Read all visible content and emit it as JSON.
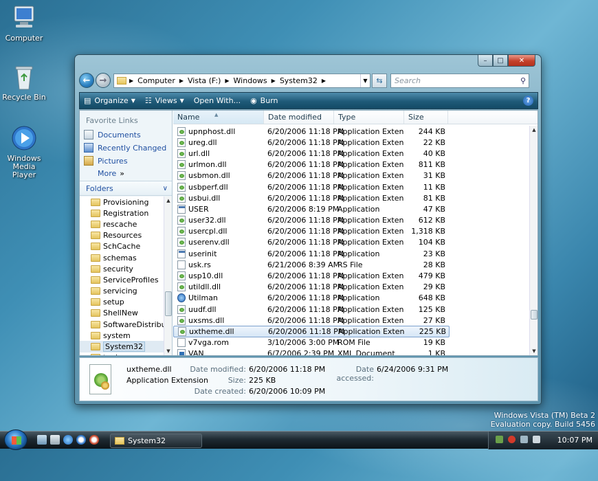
{
  "desktop": {
    "icons": [
      {
        "label": "Computer"
      },
      {
        "label": "Recycle Bin"
      },
      {
        "label": "Windows Media Player"
      }
    ],
    "watermark": {
      "line1": "Windows Vista (TM) Beta 2",
      "line2": "Evaluation copy. Build 5456"
    }
  },
  "window": {
    "caption_buttons": {
      "minimize": "–",
      "maximize": "□",
      "close": "✕"
    },
    "address": {
      "crumbs": [
        "Computer",
        "Vista (F:)",
        "Windows",
        "System32"
      ]
    },
    "search": {
      "placeholder": "Search"
    },
    "toolbar": {
      "organize": "Organize",
      "views": "Views",
      "open_with": "Open With...",
      "burn": "Burn",
      "help": "?"
    },
    "nav": {
      "favorite_links_title": "Favorite Links",
      "favorites": [
        "Documents",
        "Recently Changed",
        "Pictures"
      ],
      "more": "More",
      "folders_title": "Folders",
      "tree": [
        "Provisioning",
        "Registration",
        "rescache",
        "Resources",
        "SchCache",
        "schemas",
        "security",
        "ServiceProfiles",
        "servicing",
        "setup",
        "ShellNew",
        "SoftwareDistributio",
        "system",
        "System32",
        "tapi"
      ],
      "selected_tree": "System32"
    },
    "columns": {
      "name": "Name",
      "date": "Date modified",
      "type": "Type",
      "size": "Size"
    },
    "files": [
      {
        "name": "upnphost.dll",
        "date": "6/20/2006 11:18 PM",
        "type": "Application Extens...",
        "size": "244 KB",
        "icon": "dll"
      },
      {
        "name": "ureg.dll",
        "date": "6/20/2006 11:18 PM",
        "type": "Application Extens...",
        "size": "22 KB",
        "icon": "dll"
      },
      {
        "name": "url.dll",
        "date": "6/20/2006 11:18 PM",
        "type": "Application Extens...",
        "size": "40 KB",
        "icon": "dll"
      },
      {
        "name": "urlmon.dll",
        "date": "6/20/2006 11:18 PM",
        "type": "Application Extens...",
        "size": "811 KB",
        "icon": "dll"
      },
      {
        "name": "usbmon.dll",
        "date": "6/20/2006 11:18 PM",
        "type": "Application Extens...",
        "size": "31 KB",
        "icon": "dll"
      },
      {
        "name": "usbperf.dll",
        "date": "6/20/2006 11:18 PM",
        "type": "Application Extens...",
        "size": "11 KB",
        "icon": "dll"
      },
      {
        "name": "usbui.dll",
        "date": "6/20/2006 11:18 PM",
        "type": "Application Extens...",
        "size": "81 KB",
        "icon": "dll"
      },
      {
        "name": "USER",
        "date": "6/20/2006 8:19 PM",
        "type": "Application",
        "size": "47 KB",
        "icon": "app"
      },
      {
        "name": "user32.dll",
        "date": "6/20/2006 11:18 PM",
        "type": "Application Extens...",
        "size": "612 KB",
        "icon": "dll"
      },
      {
        "name": "usercpl.dll",
        "date": "6/20/2006 11:18 PM",
        "type": "Application Extens...",
        "size": "1,318 KB",
        "icon": "dll"
      },
      {
        "name": "userenv.dll",
        "date": "6/20/2006 11:18 PM",
        "type": "Application Extens...",
        "size": "104 KB",
        "icon": "dll"
      },
      {
        "name": "userinit",
        "date": "6/20/2006 11:18 PM",
        "type": "Application",
        "size": "23 KB",
        "icon": "app"
      },
      {
        "name": "usk.rs",
        "date": "6/21/2006 8:39 AM",
        "type": "RS File",
        "size": "28 KB",
        "icon": "blank"
      },
      {
        "name": "usp10.dll",
        "date": "6/20/2006 11:18 PM",
        "type": "Application Extens...",
        "size": "479 KB",
        "icon": "dll"
      },
      {
        "name": "utildll.dll",
        "date": "6/20/2006 11:18 PM",
        "type": "Application Extens...",
        "size": "29 KB",
        "icon": "dll"
      },
      {
        "name": "Utilman",
        "date": "6/20/2006 11:18 PM",
        "type": "Application",
        "size": "648 KB",
        "icon": "util"
      },
      {
        "name": "uudf.dll",
        "date": "6/20/2006 11:18 PM",
        "type": "Application Extens...",
        "size": "125 KB",
        "icon": "dll"
      },
      {
        "name": "uxsms.dll",
        "date": "6/20/2006 11:18 PM",
        "type": "Application Extens...",
        "size": "27 KB",
        "icon": "dll"
      },
      {
        "name": "uxtheme.dll",
        "date": "6/20/2006 11:18 PM",
        "type": "Application Extens...",
        "size": "225 KB",
        "icon": "dll"
      },
      {
        "name": "v7vga.rom",
        "date": "3/10/2006 3:00 PM",
        "type": "ROM File",
        "size": "19 KB",
        "icon": "blank"
      },
      {
        "name": "VAN",
        "date": "6/7/2006 2:39 PM",
        "type": "XML Document",
        "size": "1 KB",
        "icon": "xml"
      }
    ],
    "selected_file": "uxtheme.dll",
    "details": {
      "name": "uxtheme.dll",
      "type": "Application Extension",
      "date_modified_label": "Date modified:",
      "date_modified": "6/20/2006 11:18 PM",
      "size_label": "Size:",
      "size": "225 KB",
      "date_created_label": "Date created:",
      "date_created": "6/20/2006 10:09 PM",
      "date_accessed_label": "Date accessed:",
      "date_accessed": "6/24/2006 9:31 PM"
    }
  },
  "taskbar": {
    "task_label": "System32",
    "clock": "10:07 PM"
  }
}
